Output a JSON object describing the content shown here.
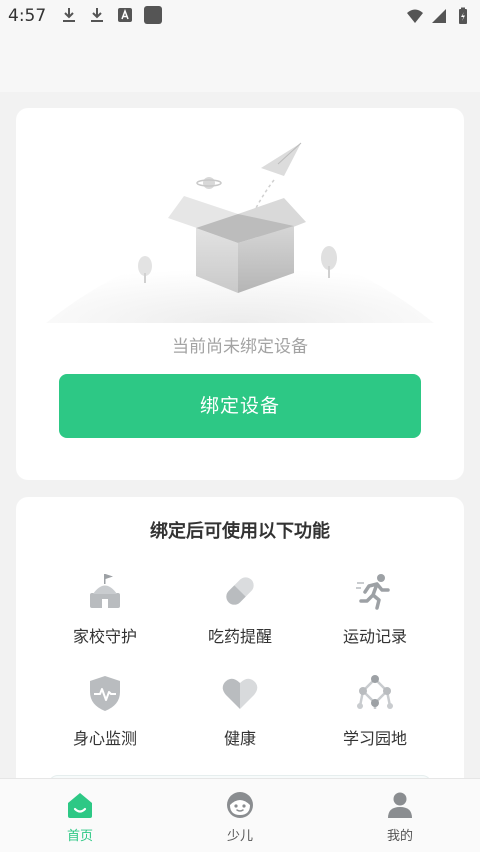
{
  "status_bar": {
    "time": "4:57",
    "left_icons": [
      "download-icon",
      "download-icon",
      "font-icon",
      "square-app-icon"
    ],
    "right_icons": [
      "wifi-icon",
      "signal-icon",
      "battery-icon"
    ]
  },
  "bind_card": {
    "empty_text": "当前尚未绑定设备",
    "button_label": "绑定设备"
  },
  "features": {
    "title": "绑定后可使用以下功能",
    "items": [
      {
        "label": "家校守护",
        "icon": "school-icon"
      },
      {
        "label": "吃药提醒",
        "icon": "pill-icon"
      },
      {
        "label": "运动记录",
        "icon": "running-icon"
      },
      {
        "label": "身心监测",
        "icon": "shield-heartbeat-icon"
      },
      {
        "label": "健康",
        "icon": "heart-icon"
      },
      {
        "label": "学习园地",
        "icon": "molecule-icon"
      }
    ]
  },
  "tab_bar": {
    "tabs": [
      {
        "label": "首页",
        "icon": "home-icon",
        "active": true
      },
      {
        "label": "少儿",
        "icon": "child-face-icon",
        "active": false
      },
      {
        "label": "我的",
        "icon": "person-icon",
        "active": false
      }
    ]
  },
  "colors": {
    "accent": "#2dc885",
    "background": "#f2f2f2",
    "card": "#ffffff",
    "muted_text": "#a3a3a3",
    "icon_gray": "#b9bcbf"
  }
}
